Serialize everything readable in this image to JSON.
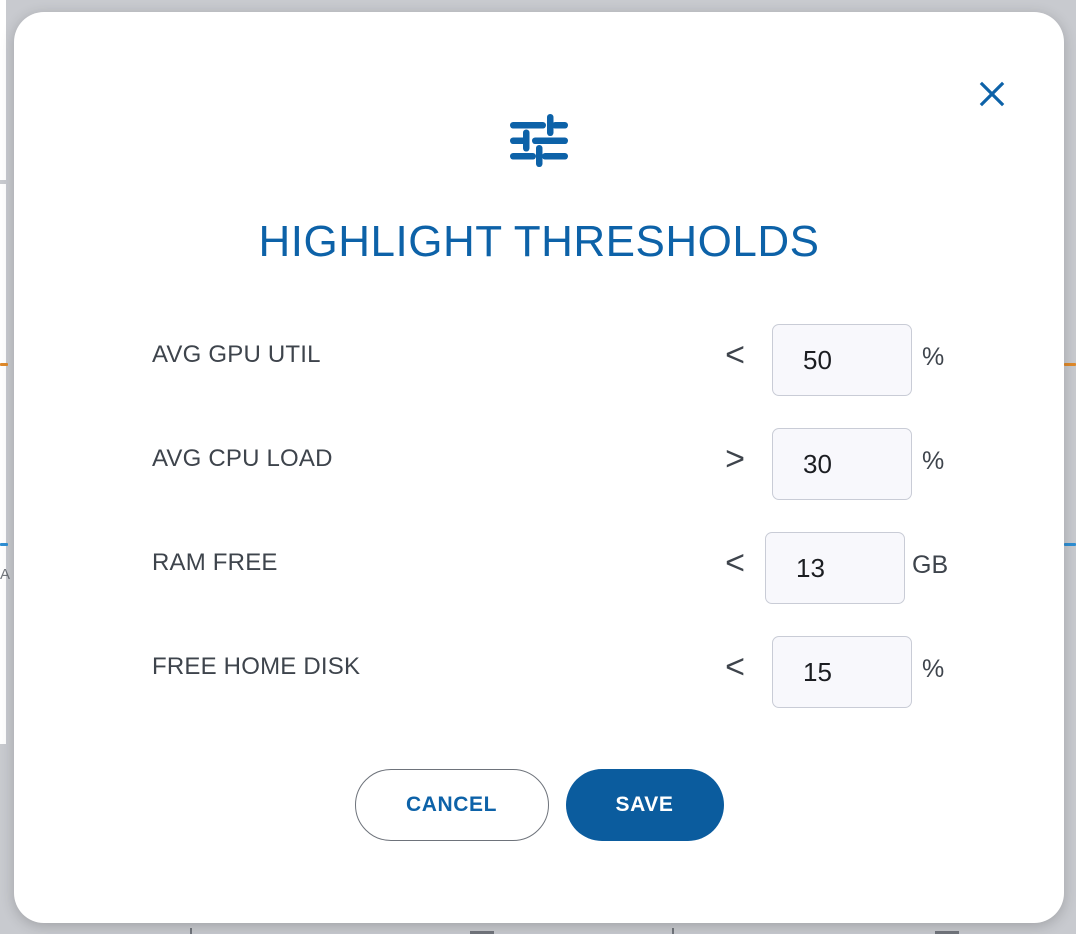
{
  "dialog": {
    "icon": "tune-sliders-icon",
    "title": "HIGHLIGHT THRESHOLDS",
    "close_icon": "close-icon",
    "accent_color": "#0d62a8",
    "save_fill_color": "#0b5c9e",
    "label_color": "#3e444c",
    "rows": [
      {
        "label": "AVG GPU UTIL",
        "operator": "<",
        "value": "50",
        "unit": "%"
      },
      {
        "label": "AVG CPU LOAD",
        "operator": ">",
        "value": "30",
        "unit": "%"
      },
      {
        "label": "RAM FREE",
        "operator": "<",
        "value": "13",
        "unit": "GB"
      },
      {
        "label": "FREE HOME DISK",
        "operator": "<",
        "value": "15",
        "unit": "%"
      }
    ],
    "buttons": {
      "cancel_label": "CANCEL",
      "save_label": "SAVE"
    }
  },
  "background": {
    "letter_fragment": "A",
    "rule_orange_color": "#e08a2b",
    "rule_blue_color": "#2f8fd4",
    "overlay_color": "#c8cacf"
  }
}
